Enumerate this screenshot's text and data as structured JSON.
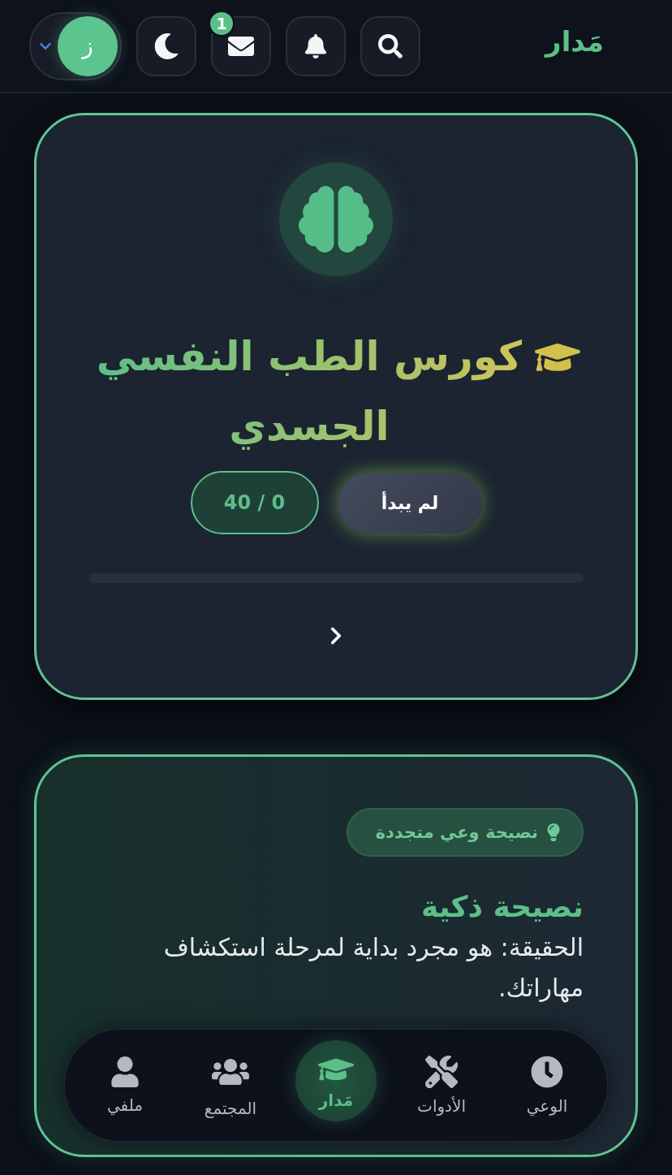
{
  "header": {
    "logo": "مَدار",
    "mail_badge": "1",
    "avatar_initial": "ز"
  },
  "course": {
    "title": "كورس الطب النفسي الجسدي",
    "status": "لم يبدأ",
    "count": "40 / 0"
  },
  "tip": {
    "tag": "نصيحة وعي متجددة",
    "title": "نصيحة ذكية",
    "text": "الحقيقة: هو مجرد بداية لمرحلة استكشاف مهاراتك."
  },
  "bottom_nav": [
    {
      "kind": "awareness",
      "label": "الوعي",
      "selected": false
    },
    {
      "kind": "tools",
      "label": "الأدوات",
      "selected": false
    },
    {
      "kind": "home",
      "label": "مَدار",
      "selected": true
    },
    {
      "kind": "community",
      "label": "المجتمع",
      "selected": false
    },
    {
      "kind": "profile",
      "label": "ملفي",
      "selected": false
    }
  ]
}
